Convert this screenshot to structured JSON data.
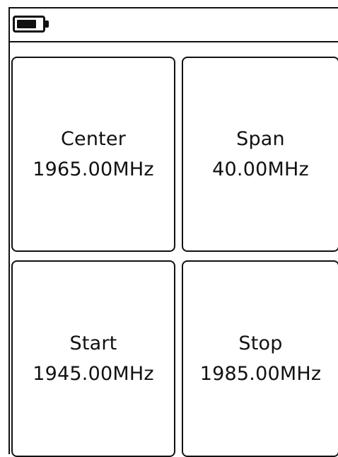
{
  "status_bar": {
    "battery_icon": "battery-icon",
    "battery_level": 0.8
  },
  "tiles": [
    {
      "label": "Center",
      "value": "1965.00MHz"
    },
    {
      "label": "Span",
      "value": "40.00MHz"
    },
    {
      "label": "Start",
      "value": "1945.00MHz"
    },
    {
      "label": "Stop",
      "value": "1985.00MHz"
    }
  ],
  "colors": {
    "foreground": "#111111",
    "background": "#ffffff"
  }
}
